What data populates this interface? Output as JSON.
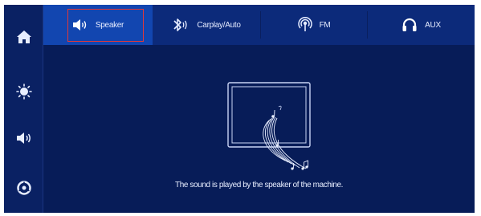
{
  "sidebar": {
    "items": [
      {
        "icon": "home-icon"
      },
      {
        "icon": "brightness-icon"
      },
      {
        "icon": "volume-icon"
      },
      {
        "icon": "settings-icon"
      }
    ]
  },
  "tabs": [
    {
      "label": "Speaker",
      "icon": "speaker-icon",
      "active": true
    },
    {
      "label": "Carplay/Auto",
      "icon": "bluetooth-audio-icon",
      "active": false
    },
    {
      "label": "FM",
      "icon": "radio-icon",
      "active": false
    },
    {
      "label": "AUX",
      "icon": "headphones-icon",
      "active": false
    }
  ],
  "main": {
    "message": "The sound is played by the speaker of the machine."
  },
  "colors": {
    "background": "#071c58",
    "tab_bar": "#0c2a7a",
    "active_tab": "#1246b0",
    "highlight_border": "#e0383a"
  }
}
